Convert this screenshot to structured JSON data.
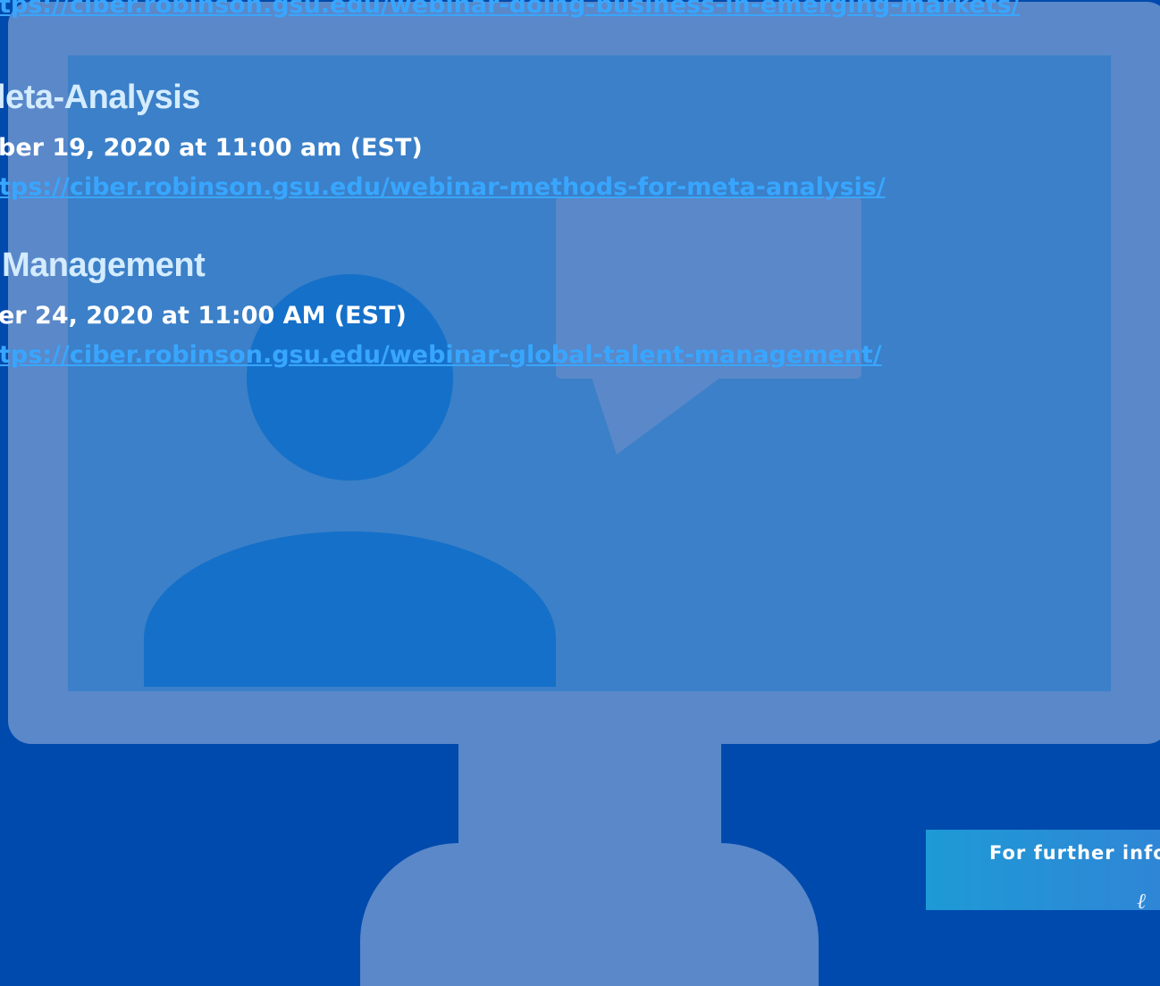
{
  "webinars": [
    {
      "title": "",
      "date": "",
      "link": "tps://ciber.robinson.gsu.edu/webinar-doing-business-in-emerging-markets/"
    },
    {
      "title": "leta-Analysis",
      "date": "ber 19, 2020 at 11:00 am (EST)",
      "link": "tps://ciber.robinson.gsu.edu/webinar-methods-for-meta-analysis/"
    },
    {
      "title": "Management",
      "date": "er 24, 2020 at 11:00 AM (EST)",
      "link": "tps://ciber.robinson.gsu.edu/webinar-global-talent-management/"
    }
  ],
  "info_box": {
    "text": "For further info"
  },
  "colors": {
    "background": "#004aad",
    "monitor": "#5a88c9",
    "screen": "#3b80c8",
    "person": "#1570c9",
    "title": "#d4ecff",
    "link": "#38a6ff"
  },
  "icons": [
    "monitor-icon",
    "person-icon",
    "speech-bubble-icon",
    "logo-icon"
  ]
}
